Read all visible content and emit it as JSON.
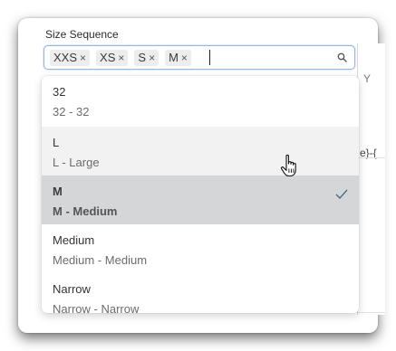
{
  "field": {
    "label": "Size Sequence",
    "tags": [
      {
        "label": "XXS",
        "remove": "×"
      },
      {
        "label": "XS",
        "remove": "×"
      },
      {
        "label": "S",
        "remove": "×"
      },
      {
        "label": "M",
        "remove": "×"
      }
    ]
  },
  "dropdown": {
    "options": [
      {
        "code": "32",
        "description": "32 - 32",
        "state": "normal"
      },
      {
        "code": "L",
        "description": "L - Large",
        "state": "hover"
      },
      {
        "code": "M",
        "description": "M - Medium",
        "state": "selected"
      },
      {
        "code": "Medium",
        "description": "Medium - Medium",
        "state": "normal"
      },
      {
        "code": "Narrow",
        "description": "Narrow - Narrow",
        "state": "normal"
      }
    ]
  },
  "background_peek": {
    "text": "e}-{",
    "label_fragment": "Y"
  },
  "colors": {
    "focus_border": "#93b7e0",
    "selected_bg": "#d4d6d8",
    "hover_bg": "#f2f2f2",
    "tag_bg": "#ededed"
  }
}
